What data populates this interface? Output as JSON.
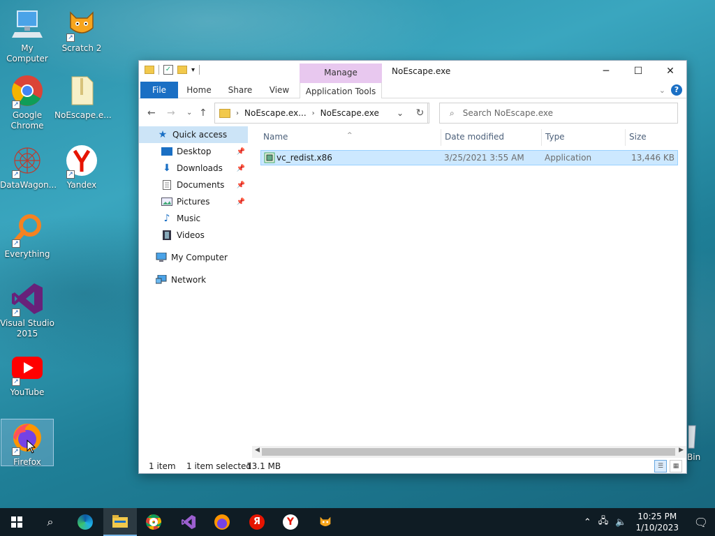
{
  "desktop": {
    "icons": [
      {
        "label": "My Computer"
      },
      {
        "label": "Scratch 2"
      },
      {
        "label": "Google Chrome"
      },
      {
        "label": "NoEscape.e..."
      },
      {
        "label": "DataWagon..."
      },
      {
        "label": "Yandex"
      },
      {
        "label": "Everything"
      },
      {
        "label": "Visual Studio 2015"
      },
      {
        "label": "YouTube"
      },
      {
        "label": "Firefox"
      },
      {
        "label": "Bin"
      }
    ]
  },
  "window": {
    "title": "NoEscape.exe",
    "contextual_tab": "Manage",
    "ribbon_tabs": [
      "File",
      "Home",
      "Share",
      "View",
      "Application Tools"
    ],
    "address": {
      "crumbs": [
        "NoEscape.ex...",
        "NoEscape.exe"
      ]
    },
    "search": {
      "placeholder": "Search NoEscape.exe"
    },
    "nav": {
      "quick_access": "Quick access",
      "items": [
        "Desktop",
        "Downloads",
        "Documents",
        "Pictures",
        "Music",
        "Videos"
      ],
      "my_computer": "My Computer",
      "network": "Network"
    },
    "columns": {
      "name": "Name",
      "date": "Date modified",
      "type": "Type",
      "size": "Size"
    },
    "files": [
      {
        "name": "vc_redist.x86",
        "date": "3/25/2021 3:55 AM",
        "type": "Application",
        "size": "13,446 KB"
      }
    ],
    "status": {
      "count": "1 item",
      "selected": "1 item selected",
      "size": "13.1 MB"
    }
  },
  "taskbar": {
    "time": "10:25 PM",
    "date": "1/10/2023"
  },
  "colors": {
    "accent": "#1a6fc4",
    "selection": "#cce8ff",
    "manage_tab": "#e8c8ef",
    "taskbar": "#0f1c24"
  }
}
